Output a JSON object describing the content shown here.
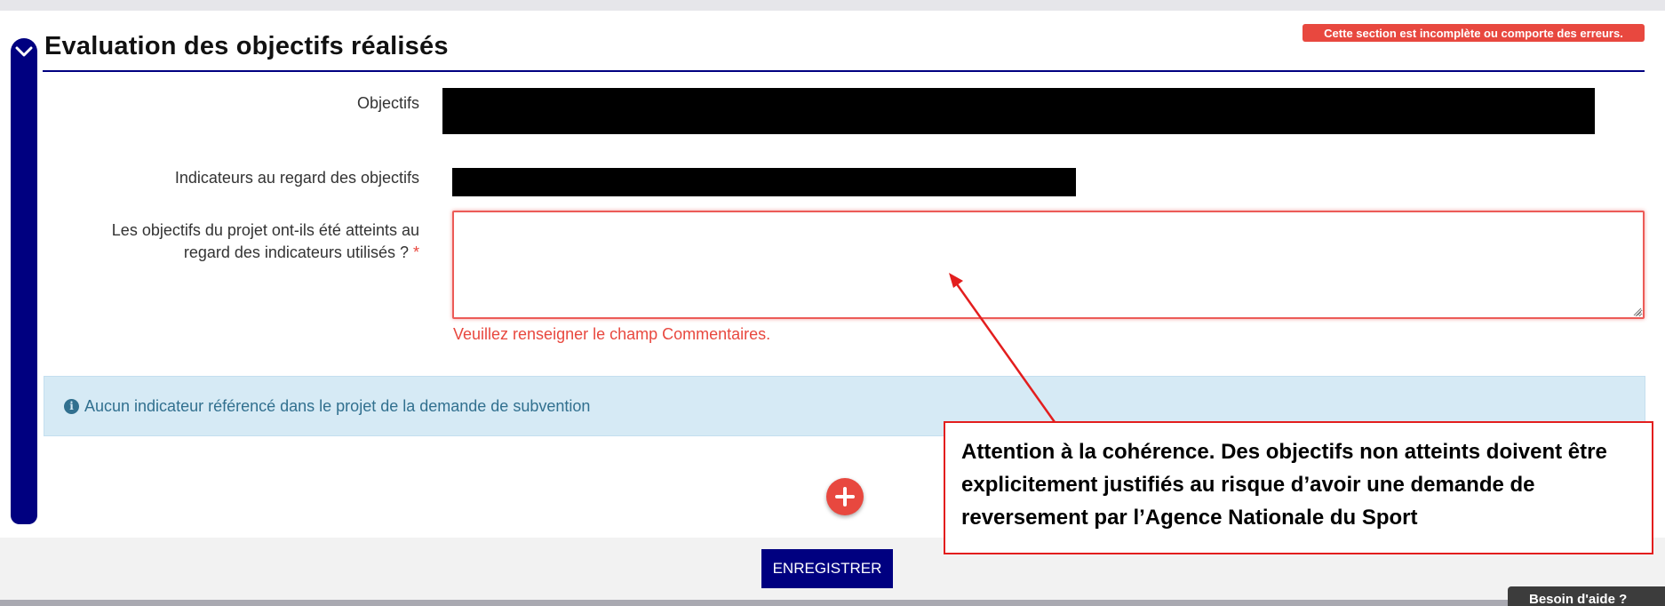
{
  "section": {
    "title": "Evaluation des objectifs réalisés",
    "error_badge": "Cette section est incomplète ou comporte des erreurs."
  },
  "form": {
    "objectives_label": "Objectifs",
    "indicators_label": "Indicateurs au regard des objectifs",
    "question_label_line1": "Les objectifs du projet ont-ils été atteints au",
    "question_label_line2": "regard des indicateurs utilisés ?",
    "required_mark": "*",
    "comment_value": "",
    "error_message": "Veuillez renseigner le champ Commentaires."
  },
  "info_alert": {
    "icon": "info-circle-icon",
    "text": "Aucun indicateur référencé dans le projet de la demande de subvention"
  },
  "add_button": {
    "icon": "plus-circle-icon"
  },
  "footer": {
    "save_label": "ENREGISTRER",
    "help_label": "Besoin d'aide ?"
  },
  "callout": {
    "text": "Attention à la cohérence. Des objectifs non atteints doivent être explicitement justifiés au risque d’avoir une demande de reversement par l’Agence Nationale du Sport"
  },
  "colors": {
    "primary": "#000080",
    "error": "#e8483f",
    "info_bg": "#d6eaf5",
    "info_text": "#31708f",
    "callout_border": "#e31e1e"
  }
}
